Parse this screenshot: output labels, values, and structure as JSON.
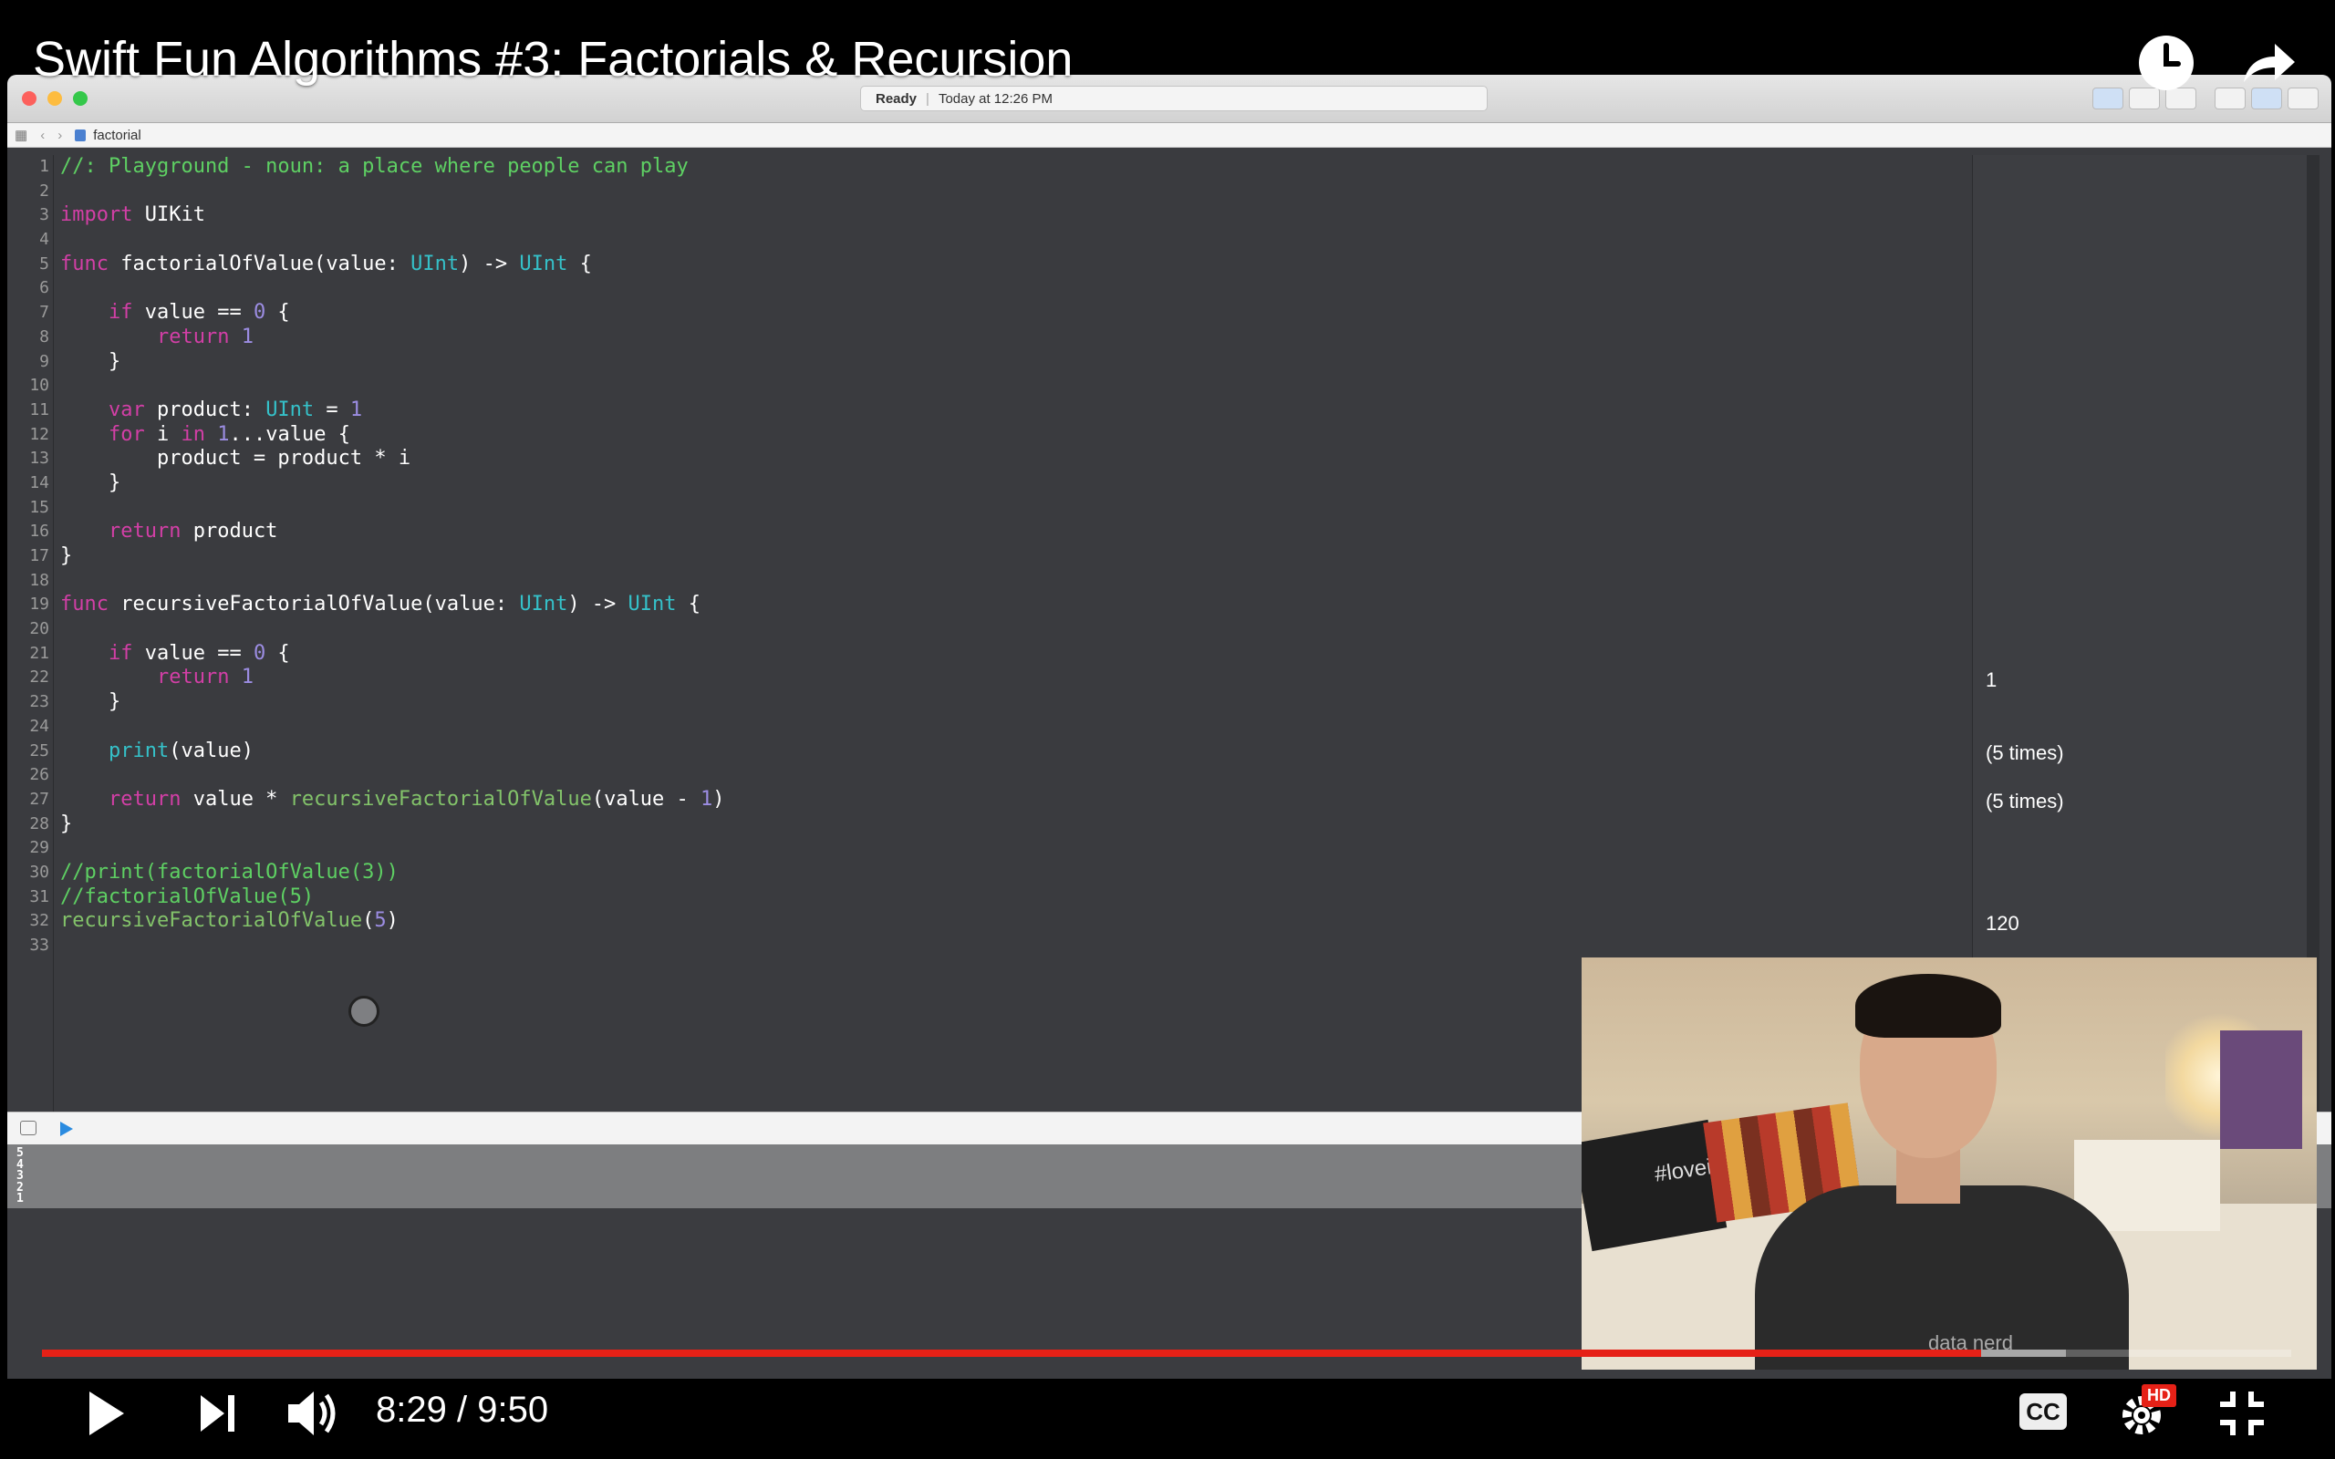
{
  "video": {
    "title": "Swift Fun Algorithms #3: Factorials & Recursion",
    "current_time": "8:29",
    "time_separator": "/",
    "duration": "9:50",
    "progress_fraction": 0.862,
    "buffered_fraction": 0.9,
    "cc_label": "CC",
    "hd_badge": "HD",
    "webcam_shirt_text": "data nerd",
    "webcam_pillow_text": "#loveit",
    "colors": {
      "progress": "#e62117",
      "background": "#000000"
    }
  },
  "xcode": {
    "status": {
      "state": "Ready",
      "time": "Today at 12:26 PM"
    },
    "jumpbar": {
      "file": "factorial"
    },
    "code_lines": [
      {
        "n": "1",
        "html": "<span class='cm'>//: Playground - noun: a place where people can play</span>"
      },
      {
        "n": "2",
        "html": ""
      },
      {
        "n": "3",
        "html": "<span class='kw'>import</span> UIKit"
      },
      {
        "n": "4",
        "html": ""
      },
      {
        "n": "5",
        "html": "<span class='kw'>func</span> factorialOfValue(value: <span class='ty'>UInt</span>) -> <span class='ty'>UInt</span> {"
      },
      {
        "n": "6",
        "html": ""
      },
      {
        "n": "7",
        "html": "    <span class='kw'>if</span> value == <span class='num'>0</span> {"
      },
      {
        "n": "8",
        "html": "        <span class='kw'>return</span> <span class='num'>1</span>"
      },
      {
        "n": "9",
        "html": "    }"
      },
      {
        "n": "10",
        "html": ""
      },
      {
        "n": "11",
        "html": "    <span class='kw'>var</span> product: <span class='ty'>UInt</span> = <span class='num'>1</span>"
      },
      {
        "n": "12",
        "html": "    <span class='kw'>for</span> i <span class='kw'>in</span> <span class='num'>1</span>...value {"
      },
      {
        "n": "13",
        "html": "        product = product * i"
      },
      {
        "n": "14",
        "html": "    }"
      },
      {
        "n": "15",
        "html": ""
      },
      {
        "n": "16",
        "html": "    <span class='kw'>return</span> product"
      },
      {
        "n": "17",
        "html": "}"
      },
      {
        "n": "18",
        "html": ""
      },
      {
        "n": "19",
        "html": "<span class='kw'>func</span> recursiveFactorialOfValue(value: <span class='ty'>UInt</span>) -> <span class='ty'>UInt</span> {"
      },
      {
        "n": "20",
        "html": ""
      },
      {
        "n": "21",
        "html": "    <span class='kw'>if</span> value == <span class='num'>0</span> {"
      },
      {
        "n": "22",
        "html": "        <span class='kw'>return</span> <span class='num'>1</span>"
      },
      {
        "n": "23",
        "html": "    }"
      },
      {
        "n": "24",
        "html": ""
      },
      {
        "n": "25",
        "html": "    <span class='pf'>print</span>(value)"
      },
      {
        "n": "26",
        "html": ""
      },
      {
        "n": "27",
        "html": "    <span class='kw'>return</span> value * <span class='fn'>recursiveFactorialOfValue</span>(value - <span class='num'>1</span>)"
      },
      {
        "n": "28",
        "html": "}"
      },
      {
        "n": "29",
        "html": ""
      },
      {
        "n": "30",
        "html": "<span class='cm'>//print(factorialOfValue(3))</span>"
      },
      {
        "n": "31",
        "html": "<span class='cm'>//factorialOfValue(5)</span>"
      },
      {
        "n": "32",
        "html": "<span class='fn'>recursiveFactorialOfValue</span>(<span class='num'>5</span>)"
      },
      {
        "n": "33",
        "html": ""
      }
    ],
    "results": [
      {
        "line": 22,
        "text": "1"
      },
      {
        "line": 25,
        "text": "(5 times)"
      },
      {
        "line": 27,
        "text": "(5 times)"
      },
      {
        "line": 32,
        "text": "120"
      }
    ],
    "console_output": [
      "5",
      "4",
      "3",
      "2",
      "1"
    ]
  }
}
